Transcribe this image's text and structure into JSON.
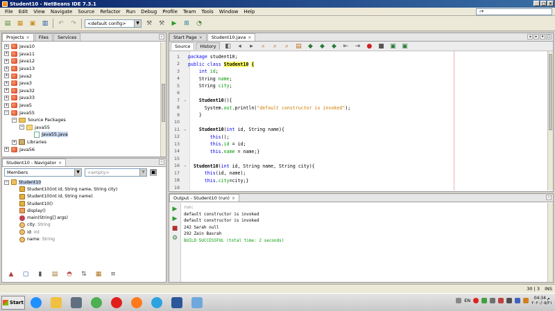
{
  "window": {
    "title": "Student10 - NetBeans IDE 7.3.1"
  },
  "menu": [
    "File",
    "Edit",
    "View",
    "Navigate",
    "Source",
    "Refactor",
    "Run",
    "Debug",
    "Profile",
    "Team",
    "Tools",
    "Window",
    "Help"
  ],
  "search": {
    "placeholder": ""
  },
  "toolbar": {
    "config": "<default config>"
  },
  "projects_panel": {
    "tabs": [
      {
        "label": "Projects",
        "active": true
      },
      {
        "label": "Files",
        "active": false
      },
      {
        "label": "Services",
        "active": false
      }
    ],
    "items": [
      {
        "label": "Java10",
        "type": "project",
        "exp": "+",
        "indent": 0
      },
      {
        "label": "Java11",
        "type": "project",
        "exp": "+",
        "indent": 0
      },
      {
        "label": "Java12",
        "type": "project",
        "exp": "+",
        "indent": 0
      },
      {
        "label": "Java13",
        "type": "project",
        "exp": "+",
        "indent": 0
      },
      {
        "label": "Java2",
        "type": "project",
        "exp": "+",
        "indent": 0
      },
      {
        "label": "Java3",
        "type": "project",
        "exp": "+",
        "indent": 0
      },
      {
        "label": "Java32",
        "type": "project",
        "exp": "+",
        "indent": 0
      },
      {
        "label": "Java33",
        "type": "project",
        "exp": "+",
        "indent": 0
      },
      {
        "label": "Java5",
        "type": "project",
        "exp": "+",
        "indent": 0
      },
      {
        "label": "Java55",
        "type": "project",
        "exp": "−",
        "indent": 0
      },
      {
        "label": "Source Packages",
        "type": "folder",
        "exp": "−",
        "indent": 1
      },
      {
        "label": "java55",
        "type": "package",
        "exp": "−",
        "indent": 2
      },
      {
        "label": "Java55.java",
        "type": "file",
        "exp": "",
        "indent": 3,
        "selected": true
      },
      {
        "label": "Libraries",
        "type": "library",
        "exp": "+",
        "indent": 1
      },
      {
        "label": "Java56",
        "type": "project",
        "exp": "+",
        "indent": 0
      }
    ]
  },
  "navigator_panel": {
    "tab": "Student10 - Navigator",
    "filter_label": "Members",
    "filter_value": "<empty>",
    "root": "Student10",
    "members": [
      {
        "kind": "ctor",
        "name": "Student10",
        "params": "(int id, String name, String city)"
      },
      {
        "kind": "ctor",
        "name": "Student10",
        "params": "(int id, String name)"
      },
      {
        "kind": "ctor",
        "name": "Student10",
        "params": "()"
      },
      {
        "kind": "method",
        "name": "display",
        "params": "()"
      },
      {
        "kind": "static",
        "name": "main",
        "params": "(String[] args)"
      },
      {
        "kind": "field",
        "name": "city",
        "params": " : String"
      },
      {
        "kind": "field",
        "name": "id",
        "params": " : int"
      },
      {
        "kind": "field",
        "name": "name",
        "params": " : String"
      }
    ]
  },
  "editor": {
    "tabs": [
      {
        "label": "Start Page",
        "active": false
      },
      {
        "label": "Student10.java",
        "active": true
      }
    ],
    "subtabs": [
      "Source",
      "History"
    ],
    "lines": [
      {
        "n": "1",
        "fold": "",
        "parts": [
          [
            "kw",
            "package "
          ],
          [
            "typ",
            "student10;"
          ]
        ]
      },
      {
        "n": "2",
        "fold": "",
        "parts": [
          [
            "kw",
            "public class "
          ],
          [
            "cls-hl",
            "Student10"
          ],
          [
            "typ",
            " "
          ],
          [
            "cls-hl",
            "{"
          ]
        ]
      },
      {
        "n": "3",
        "fold": "",
        "parts": [
          [
            "typ",
            "    "
          ],
          [
            "kw",
            "int "
          ],
          [
            "fld",
            "id"
          ],
          [
            "typ",
            ";"
          ]
        ]
      },
      {
        "n": "4",
        "fold": "",
        "parts": [
          [
            "typ",
            "    String "
          ],
          [
            "fld",
            "name"
          ],
          [
            "typ",
            ";"
          ]
        ]
      },
      {
        "n": "5",
        "fold": "",
        "parts": [
          [
            "typ",
            "    String "
          ],
          [
            "fld",
            "city"
          ],
          [
            "typ",
            ";"
          ]
        ]
      },
      {
        "n": "6",
        "fold": "",
        "parts": []
      },
      {
        "n": "7",
        "fold": "−",
        "parts": [
          [
            "bold",
            "    Student10"
          ],
          [
            "typ",
            "(){"
          ]
        ]
      },
      {
        "n": "8",
        "fold": "",
        "parts": [
          [
            "typ",
            "      System."
          ],
          [
            "fld",
            "out"
          ],
          [
            "typ",
            ".println("
          ],
          [
            "str",
            "\"default constructor is invoked\""
          ],
          [
            "typ",
            ");"
          ]
        ]
      },
      {
        "n": "9",
        "fold": "",
        "parts": [
          [
            "typ",
            "    }"
          ]
        ]
      },
      {
        "n": "10",
        "fold": "",
        "parts": []
      },
      {
        "n": "11",
        "fold": "−",
        "parts": [
          [
            "bold",
            "    Student10"
          ],
          [
            "typ",
            "("
          ],
          [
            "kw",
            "int "
          ],
          [
            "typ",
            "id, String name){"
          ]
        ]
      },
      {
        "n": "12",
        "fold": "",
        "parts": [
          [
            "typ",
            "        "
          ],
          [
            "kw",
            "this"
          ],
          [
            "typ",
            "();"
          ]
        ]
      },
      {
        "n": "13",
        "fold": "",
        "parts": [
          [
            "typ",
            "        "
          ],
          [
            "kw",
            "this"
          ],
          [
            "typ",
            "."
          ],
          [
            "fld",
            "id"
          ],
          [
            "typ",
            " = id;"
          ]
        ]
      },
      {
        "n": "14",
        "fold": "",
        "parts": [
          [
            "typ",
            "        "
          ],
          [
            "kw",
            "this"
          ],
          [
            "typ",
            "."
          ],
          [
            "fld",
            "name"
          ],
          [
            "typ",
            " = name;}"
          ]
        ]
      },
      {
        "n": "15",
        "fold": "",
        "parts": []
      },
      {
        "n": "16",
        "fold": "−",
        "parts": [
          [
            "bold",
            "  Student10"
          ],
          [
            "typ",
            "("
          ],
          [
            "kw",
            "int "
          ],
          [
            "typ",
            "id, String name, String city){"
          ]
        ]
      },
      {
        "n": "17",
        "fold": "",
        "parts": [
          [
            "typ",
            "      "
          ],
          [
            "kw",
            "this"
          ],
          [
            "typ",
            "(id, name);"
          ]
        ]
      },
      {
        "n": "18",
        "fold": "",
        "parts": [
          [
            "typ",
            "      "
          ],
          [
            "kw",
            "this"
          ],
          [
            "typ",
            "."
          ],
          [
            "fld",
            "city"
          ],
          [
            "typ",
            "=city;}"
          ]
        ]
      },
      {
        "n": "19",
        "fold": "",
        "parts": []
      }
    ]
  },
  "output": {
    "tab": "Output - Student10 (run)",
    "lines": [
      {
        "text": "run:",
        "color": "#808080"
      },
      {
        "text": "default constructor is invoked",
        "color": "#000000"
      },
      {
        "text": "default constructor is invoked",
        "color": "#000000"
      },
      {
        "text": "242 Sarah null",
        "color": "#000000"
      },
      {
        "text": "292 Zain Basrah",
        "color": "#000000"
      },
      {
        "text": "BUILD SUCCESSFUL (total time: 2 seconds)",
        "color": "#009900"
      }
    ]
  },
  "status": {
    "position": "30 | 3",
    "mode": "INS"
  },
  "taskbar": {
    "start": "Start",
    "apps": [
      {
        "name": "ie-icon",
        "color": "#1e90ff"
      },
      {
        "name": "explorer-icon",
        "color": "#f0c040"
      },
      {
        "name": "media-icon",
        "color": "#607080"
      },
      {
        "name": "chrome-icon",
        "color": "#4caf50"
      },
      {
        "name": "opera-icon",
        "color": "#e0201c"
      },
      {
        "name": "firefox-icon",
        "color": "#ff7a1a"
      },
      {
        "name": "telegram-icon",
        "color": "#2aa3e0"
      },
      {
        "name": "word-icon",
        "color": "#2b579a"
      },
      {
        "name": "netbeans-icon",
        "color": "#6fa8dc"
      }
    ],
    "lang": "EN",
    "time": "04:34 م",
    "date": "٢٠٢٠/٠٥/٢١"
  }
}
